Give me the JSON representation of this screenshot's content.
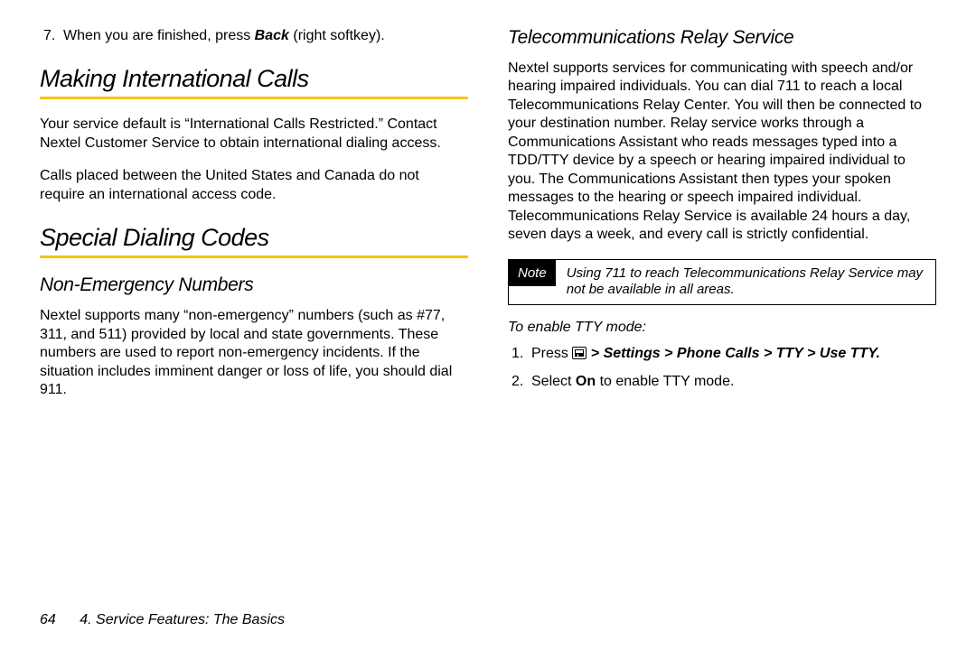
{
  "left": {
    "step7": {
      "num": "7.",
      "pre": "When you are finished, press ",
      "back": "Back",
      "post": " (right softkey)."
    },
    "h_intl": "Making International Calls",
    "p_intl1": "Your service default is “International Calls Restricted.” Contact Nextel Customer Service to obtain international dialing access.",
    "p_intl2": "Calls placed between the United States and Canada do not require an international access code.",
    "h_codes": "Special Dialing Codes",
    "h_nonemg": "Non-Emergency Numbers",
    "p_nonemg": "Nextel supports many “non-emergency” numbers (such as #77, 311, and 511) provided by local and state governments. These numbers are used to report non-emergency incidents. If the situation includes imminent danger or loss of life, you should dial 911."
  },
  "right": {
    "h_relay": "Telecommunications Relay Service",
    "p_relay": "Nextel supports services for communicating with speech and/or hearing impaired individuals. You can dial 711 to reach a local Telecommunications Relay Center. You will then be connected to your destination number. Relay service works through a Communications Assistant who reads messages typed into a TDD/TTY device by a speech or hearing impaired individual to you. The Communications Assistant then types your spoken messages to the hearing or speech impaired individual. Telecommunications Relay Service is available 24 hours a day, seven days a week, and every call is strictly confidential.",
    "note_label": "Note",
    "note_text": "Using 711 to reach Telecommunications Relay Service may not be available in all areas.",
    "tty_label": "To enable TTY mode:",
    "step1": {
      "num": "1.",
      "pre": "Press ",
      "path": " > Settings > Phone Calls > TTY > Use TTY."
    },
    "step2": {
      "num": "2.",
      "pre": "Select ",
      "on": "On",
      "post": " to enable TTY mode."
    }
  },
  "footer": {
    "page": "64",
    "chapter": "4. Service Features: The Basics"
  }
}
